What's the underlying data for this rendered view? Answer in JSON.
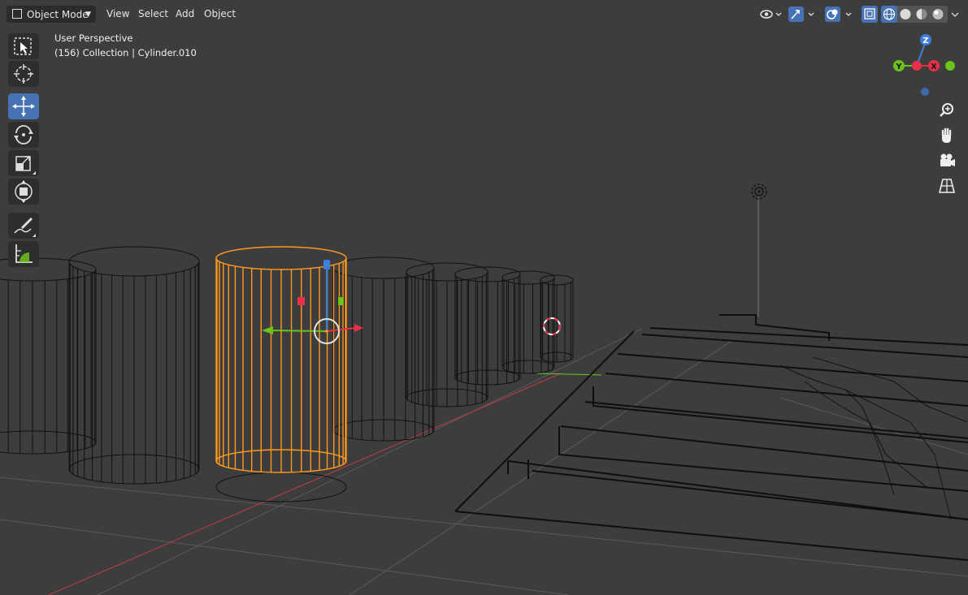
{
  "header": {
    "mode_label": "Object Mode",
    "menus": [
      "View",
      "Select",
      "Add",
      "Object"
    ]
  },
  "overlay": {
    "view_name": "User Perspective",
    "object_info": "(156) Collection | Cylinder.010"
  },
  "gizmo": {
    "z": "Z",
    "y": "Y",
    "x": "X"
  },
  "tools": [
    {
      "name": "select-box-icon",
      "active": false
    },
    {
      "name": "cursor-icon",
      "active": false
    },
    {
      "name": "move-icon",
      "active": true
    },
    {
      "name": "rotate-icon",
      "active": false
    },
    {
      "name": "scale-icon",
      "active": false
    },
    {
      "name": "transform-icon",
      "active": false
    },
    {
      "name": "annotate-icon",
      "active": false
    },
    {
      "name": "measure-icon",
      "active": false
    }
  ],
  "nav": [
    "zoom-icon",
    "hand-icon",
    "camera-icon",
    "grid-icon"
  ],
  "colors": {
    "accent": "#4772b3",
    "selection": "#ff9a1f",
    "axis_x": "#e8304a",
    "axis_y": "#6cc31b",
    "axis_z": "#3d7fd9"
  }
}
